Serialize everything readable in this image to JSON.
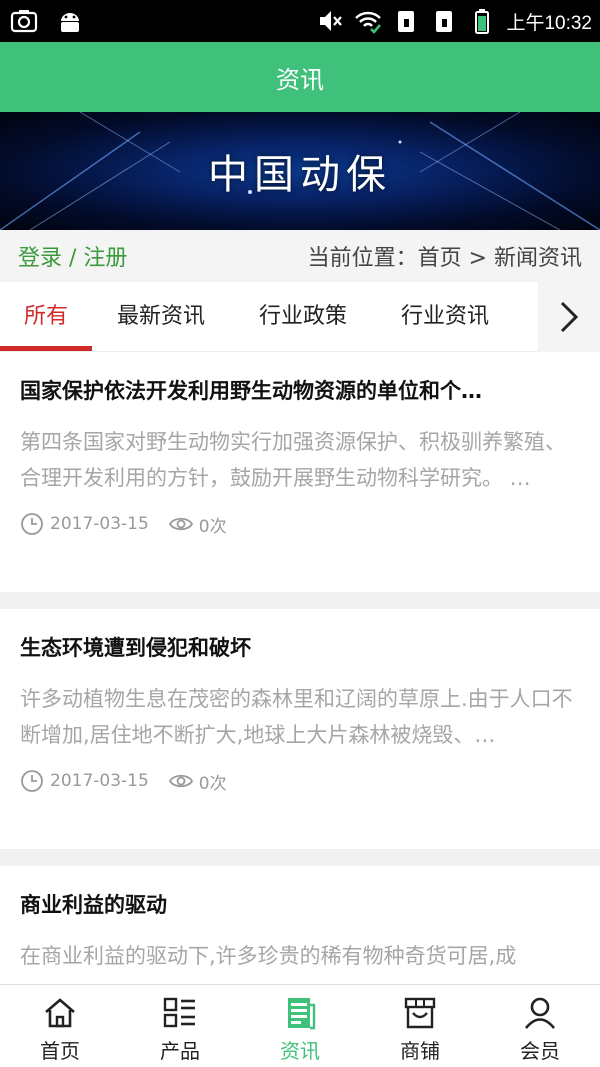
{
  "status_bar": {
    "time": "上午10:32",
    "icons": [
      "screenshot-icon",
      "android-icon",
      "mute-icon",
      "wifi-icon",
      "sim1-icon",
      "sim2-icon",
      "battery-icon"
    ]
  },
  "header": {
    "title": "资讯"
  },
  "banner": {
    "text": "中国动保"
  },
  "breadcrumb": {
    "login": "登录 / 注册",
    "location": "当前位置：首页 > 新闻资讯"
  },
  "tabs": [
    {
      "label": "所有",
      "active": true
    },
    {
      "label": "最新资讯"
    },
    {
      "label": "行业政策"
    },
    {
      "label": "行业资讯"
    }
  ],
  "news": [
    {
      "title": "国家保护依法开发利用野生动物资源的单位和个…",
      "summary": "第四条国家对野生动物实行加强资源保护、积极驯养繁殖、合理开发利用的方针，鼓励开展野生动物科学研究。 …",
      "date": "2017-03-15",
      "views": "0次"
    },
    {
      "title": "生态环境遭到侵犯和破坏",
      "summary": "许多动植物生息在茂密的森林里和辽阔的草原上.由于人口不断增加,居住地不断扩大,地球上大片森林被烧毁、…",
      "date": "2017-03-15",
      "views": "0次"
    },
    {
      "title": "商业利益的驱动",
      "summary": "在商业利益的驱动下,许多珍贵的稀有物种奇货可居,成",
      "date": "",
      "views": ""
    }
  ],
  "bottom_nav": [
    {
      "label": "首页",
      "icon": "home-icon"
    },
    {
      "label": "产品",
      "icon": "product-list-icon"
    },
    {
      "label": "资讯",
      "icon": "news-icon",
      "active": true
    },
    {
      "label": "商铺",
      "icon": "shop-icon"
    },
    {
      "label": "会员",
      "icon": "user-icon"
    }
  ],
  "colors": {
    "accent": "#3fc17c",
    "active_tab": "#d12a2a",
    "login": "#3a9a3c"
  }
}
